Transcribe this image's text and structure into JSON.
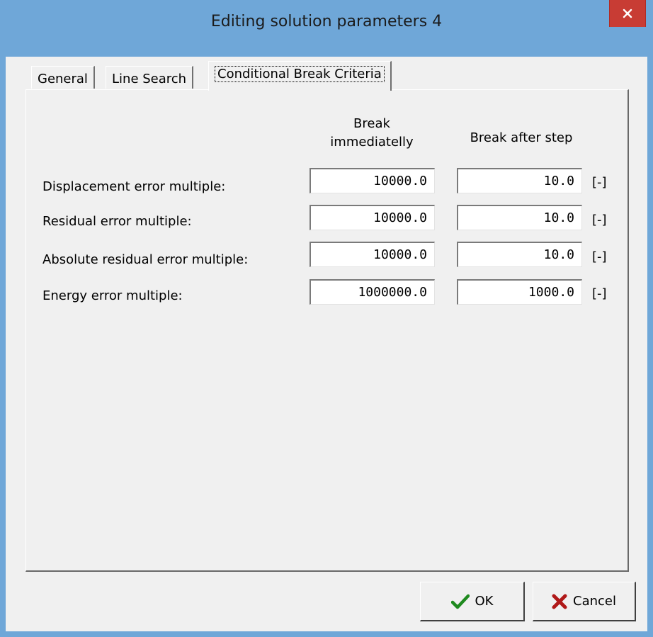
{
  "window": {
    "title": "Editing solution parameters 4",
    "accent_color": "#6fa7d8",
    "close_color": "#c83c34"
  },
  "tabs": [
    {
      "label": "General",
      "active": false
    },
    {
      "label": "Line Search",
      "active": false
    },
    {
      "label": "Conditional Break Criteria",
      "active": true
    }
  ],
  "columns": {
    "immediate_line1": "Break",
    "immediate_line2": "immediatelly",
    "after_step": "Break after step"
  },
  "rows": [
    {
      "label": "Displacement error multiple:",
      "immediate": "10000.0",
      "after_step": "10.0",
      "unit": "[-]"
    },
    {
      "label": "Residual error multiple:",
      "immediate": "10000.0",
      "after_step": "10.0",
      "unit": "[-]"
    },
    {
      "label": "Absolute residual error multiple:",
      "immediate": "10000.0",
      "after_step": "10.0",
      "unit": "[-]"
    },
    {
      "label": "Energy error multiple:",
      "immediate": "1000000.0",
      "after_step": "1000.0",
      "unit": "[-]"
    }
  ],
  "buttons": {
    "ok": {
      "label": "OK",
      "icon": "checkmark-icon"
    },
    "cancel": {
      "label": "Cancel",
      "icon": "x-mark-icon"
    }
  }
}
